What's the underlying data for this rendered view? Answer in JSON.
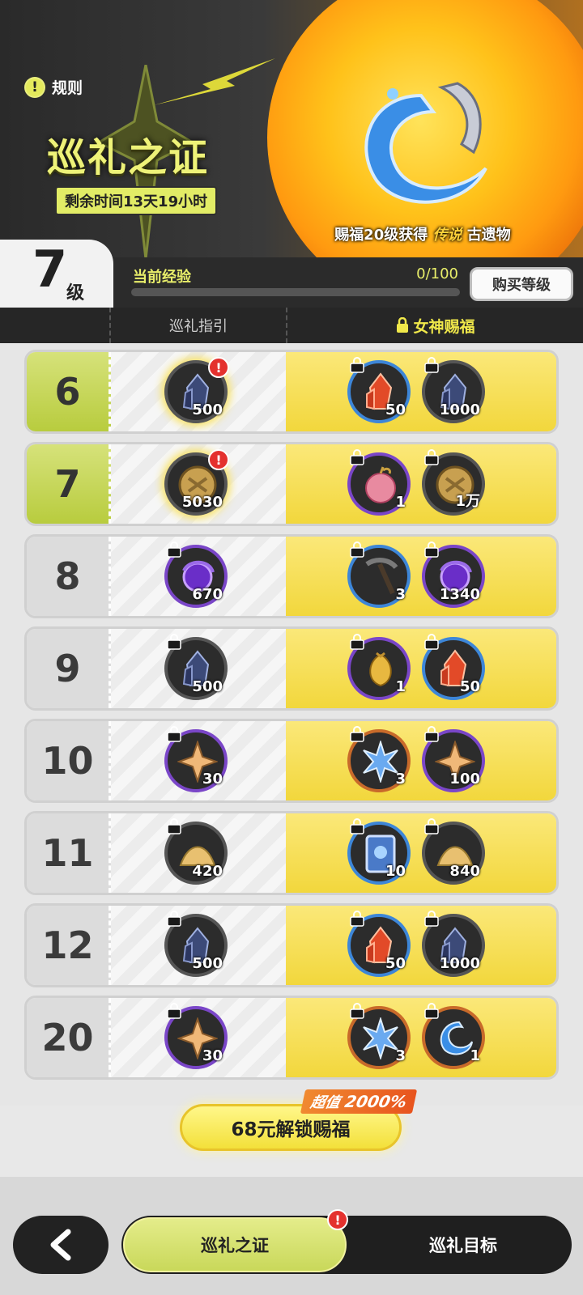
{
  "header": {
    "rules_label": "规则",
    "title": "巡礼之证",
    "remaining": "剩余时间13天19小时",
    "relic_caption_a": "赐福20级获得",
    "relic_caption_rarity": "传说",
    "relic_caption_b": "古遗物"
  },
  "level": {
    "value": "7",
    "unit": "级",
    "exp_label": "当前经验",
    "exp_text": "0/100",
    "exp_progress": 0,
    "buy_label": "购买等级"
  },
  "columns": {
    "free": "巡礼指引",
    "paid": "女神赐福"
  },
  "rows": [
    {
      "level": "6",
      "done": true,
      "free": {
        "icon": "crystal-dark-icon",
        "qty": "500",
        "alert": "!"
      },
      "paid": [
        {
          "icon": "crystal-red-icon",
          "qty": "50"
        },
        {
          "icon": "crystal-dark-icon",
          "qty": "1000"
        }
      ]
    },
    {
      "level": "7",
      "done": true,
      "free": {
        "icon": "coin-icon",
        "qty": "5030",
        "alert": "!"
      },
      "paid": [
        {
          "icon": "apple-icon",
          "qty": "1"
        },
        {
          "icon": "coin-icon",
          "qty": "1万"
        }
      ]
    },
    {
      "level": "8",
      "done": false,
      "free": {
        "icon": "purple-orb-icon",
        "qty": "670"
      },
      "paid": [
        {
          "icon": "pickaxe-icon",
          "qty": "3"
        },
        {
          "icon": "purple-orb-icon",
          "qty": "1340"
        }
      ]
    },
    {
      "level": "9",
      "done": false,
      "free": {
        "icon": "crystal-dark-icon",
        "qty": "500"
      },
      "paid": [
        {
          "icon": "gold-pouch-icon",
          "qty": "1"
        },
        {
          "icon": "crystal-red-icon",
          "qty": "50"
        }
      ]
    },
    {
      "level": "10",
      "done": false,
      "free": {
        "icon": "star-shard-icon",
        "qty": "30"
      },
      "paid": [
        {
          "icon": "ice-star-icon",
          "qty": "3"
        },
        {
          "icon": "star-shard-icon",
          "qty": "100"
        }
      ]
    },
    {
      "level": "11",
      "done": false,
      "free": {
        "icon": "sand-pile-icon",
        "qty": "420"
      },
      "paid": [
        {
          "icon": "card-icon",
          "qty": "10"
        },
        {
          "icon": "sand-pile-icon",
          "qty": "840"
        }
      ]
    },
    {
      "level": "12",
      "done": false,
      "free": {
        "icon": "crystal-dark-icon",
        "qty": "500"
      },
      "paid": [
        {
          "icon": "crystal-red-icon",
          "qty": "50"
        },
        {
          "icon": "crystal-dark-icon",
          "qty": "1000"
        }
      ]
    },
    {
      "level": "20",
      "done": false,
      "free": {
        "icon": "star-shard-icon",
        "qty": "30"
      },
      "paid": [
        {
          "icon": "ice-star-icon",
          "qty": "3"
        },
        {
          "icon": "water-blade-relic-icon",
          "qty": "1"
        }
      ]
    }
  ],
  "unlock": {
    "tag_prefix": "超值",
    "tag_value": "2000%",
    "label": "68元解锁赐福"
  },
  "nav": {
    "tab_active": "巡礼之证",
    "tab_other": "巡礼目标",
    "alert": "!"
  }
}
